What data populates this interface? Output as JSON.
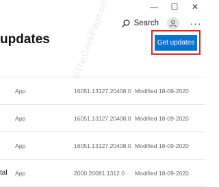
{
  "window_controls": {
    "minimize_glyph": "—",
    "maximize_glyph": "☐",
    "close_glyph": "✕"
  },
  "toolbar": {
    "search_label": "Search",
    "more_glyph": "···"
  },
  "page": {
    "title": "updates"
  },
  "actions": {
    "get_updates_label": "Get updates",
    "button_color": "#0a73cf",
    "highlight_color": "#e0262c"
  },
  "watermark": {
    "text": "©TheGeekPage.com"
  },
  "updates_list": {
    "rows": [
      {
        "name": "",
        "type": "App",
        "version": "16051.13127.20408.0",
        "modified": "Modified 18-09-2020"
      },
      {
        "name": "",
        "type": "App",
        "version": "16051.13127.20408.0",
        "modified": "Modified 18-09-2020"
      },
      {
        "name": "",
        "type": "App",
        "version": "16051.13127.20408.0",
        "modified": "Modified 18-09-2020"
      },
      {
        "name": "tal",
        "type": "App",
        "version": "2000.20081.1312.0",
        "modified": "Modified 18-09-2020"
      }
    ]
  }
}
